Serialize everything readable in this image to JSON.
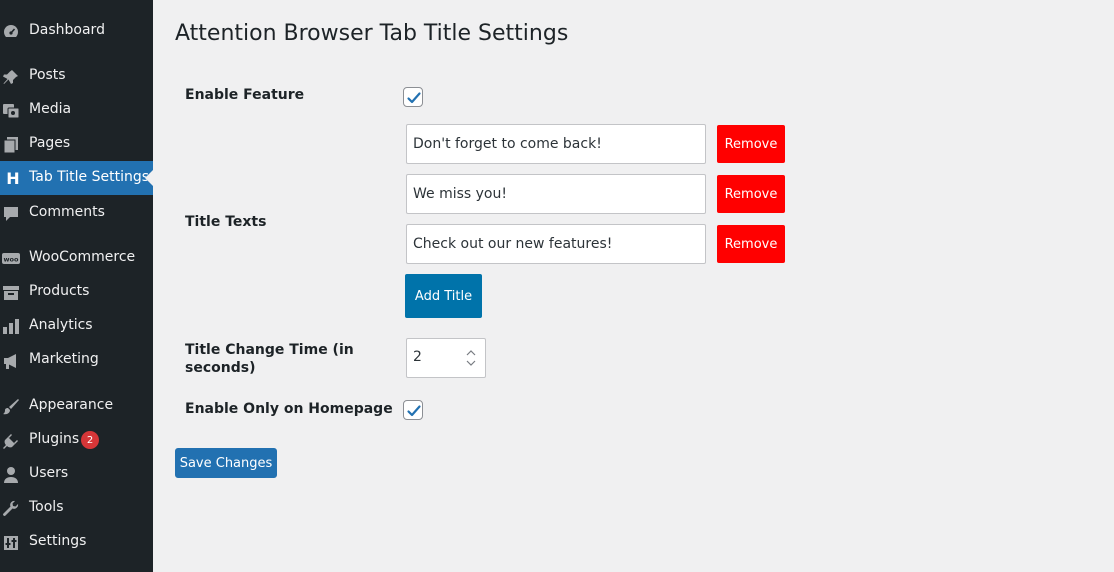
{
  "sidebar": {
    "items": [
      {
        "label": "Dashboard",
        "icon": "dashboard-icon"
      },
      {
        "label": "Posts",
        "icon": "pin-icon"
      },
      {
        "label": "Media",
        "icon": "media-icon"
      },
      {
        "label": "Pages",
        "icon": "pages-icon"
      },
      {
        "label": "Tab Title Settings",
        "icon": "h-icon",
        "active": true
      },
      {
        "label": "Comments",
        "icon": "comment-icon"
      },
      {
        "label": "WooCommerce",
        "icon": "woo-icon"
      },
      {
        "label": "Products",
        "icon": "archive-icon"
      },
      {
        "label": "Analytics",
        "icon": "bar-chart-icon"
      },
      {
        "label": "Marketing",
        "icon": "megaphone-icon"
      },
      {
        "label": "Appearance",
        "icon": "brush-icon"
      },
      {
        "label": "Plugins",
        "icon": "plug-icon",
        "badge": "2"
      },
      {
        "label": "Users",
        "icon": "user-icon"
      },
      {
        "label": "Tools",
        "icon": "wrench-icon"
      },
      {
        "label": "Settings",
        "icon": "settings-icon"
      }
    ]
  },
  "page": {
    "title": "Attention Browser Tab Title Settings"
  },
  "form": {
    "enable_feature": {
      "label": "Enable Feature",
      "checked": true
    },
    "title_texts": {
      "label": "Title Texts",
      "items": [
        {
          "value": "Don't forget to come back!",
          "remove_label": "Remove"
        },
        {
          "value": "We miss you!",
          "remove_label": "Remove"
        },
        {
          "value": "Check out our new features!",
          "remove_label": "Remove"
        }
      ],
      "add_label": "Add Title"
    },
    "title_change_time": {
      "label_line1": "Title Change Time (in",
      "label_line2": "seconds)",
      "value": "2"
    },
    "enable_homepage": {
      "label": "Enable Only on Homepage",
      "checked": true
    },
    "save_label": "Save Changes"
  },
  "colors": {
    "sidebar_bg": "#1d2327",
    "active_bg": "#2271b1",
    "remove_red": "#ff0000",
    "add_blue": "#0073aa",
    "badge_red": "#d63638"
  }
}
